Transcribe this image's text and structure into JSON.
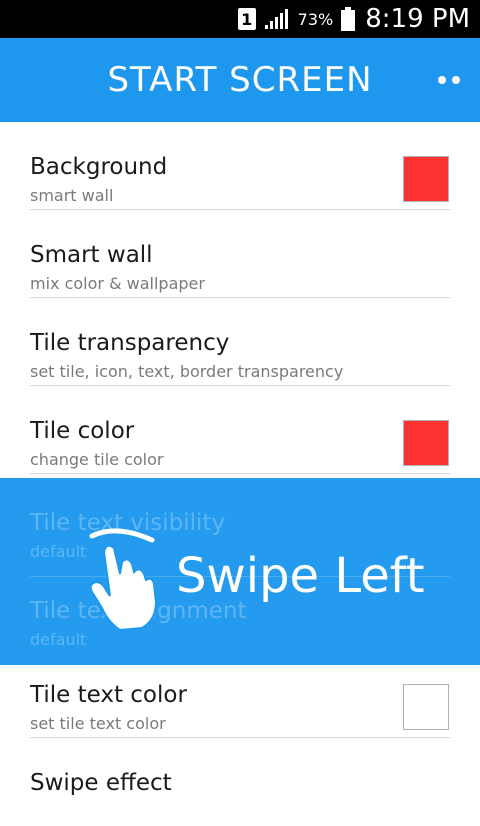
{
  "status_bar": {
    "sim": "1",
    "battery_percent": "73%",
    "time": "8:19 PM"
  },
  "app_bar": {
    "title": "START SCREEN",
    "overflow_icon": "overflow-dots-icon"
  },
  "settings": [
    {
      "title": "Background",
      "subtitle": "smart wall",
      "swatch": "#ff3333"
    },
    {
      "title": "Smart wall",
      "subtitle": "mix color & wallpaper"
    },
    {
      "title": "Tile transparency",
      "subtitle": "set tile, icon, text, border transparency"
    },
    {
      "title": "Tile color",
      "subtitle": "change tile color",
      "swatch": "#ff3333"
    },
    {
      "title": "Tile text visibility",
      "subtitle": "default"
    },
    {
      "title": "Tile text alignment",
      "subtitle": "default"
    },
    {
      "title": "Tile text color",
      "subtitle": "set tile text color",
      "swatch": "#ffffff"
    },
    {
      "title": "Swipe effect",
      "subtitle": ""
    }
  ],
  "overlay": {
    "hint": "Swipe Left",
    "icon": "swipe-hand-icon"
  },
  "colors": {
    "accent": "#1e98ee",
    "status_bar": "#000000"
  }
}
